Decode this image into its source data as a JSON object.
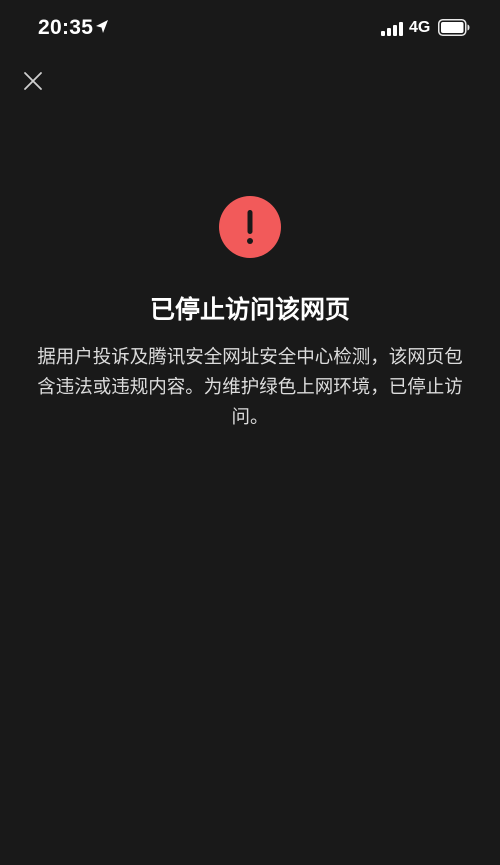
{
  "status_bar": {
    "time": "20:35",
    "location_icon": "location-arrow-icon",
    "signal_icon": "signal-bars-icon",
    "network": "4G",
    "battery_icon": "battery-icon"
  },
  "nav": {
    "close_icon": "close-icon"
  },
  "alert": {
    "icon": "exclamation-icon",
    "icon_color": "#f25a5a",
    "title": "已停止访问该网页",
    "description": "据用户投诉及腾讯安全网址安全中心检测，该网页包含违法或违规内容。为维护绿色上网环境，已停止访问。"
  },
  "colors": {
    "background": "#191919",
    "text_primary": "#ffffff",
    "text_secondary": "#dcdcdc"
  }
}
